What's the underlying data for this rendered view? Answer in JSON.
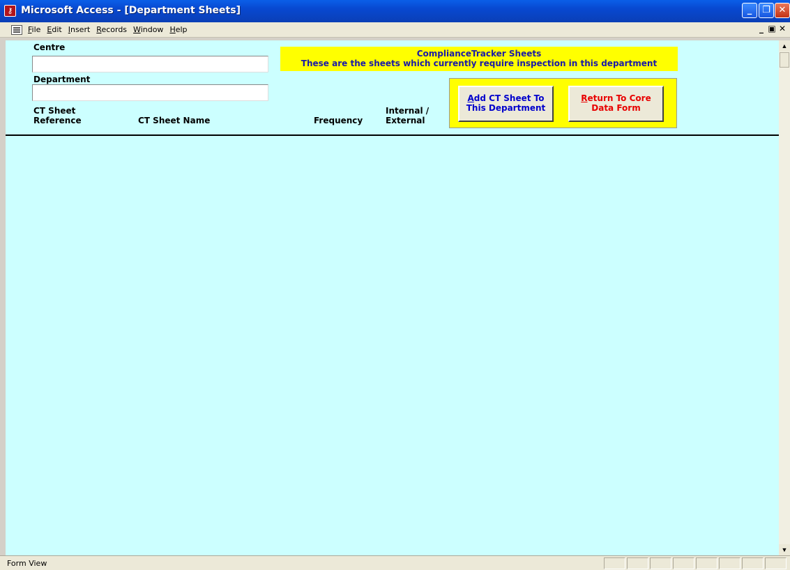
{
  "window": {
    "title": "Microsoft Access - [Department Sheets]",
    "app_icon": "access-key-icon",
    "controls": {
      "minimize": "_",
      "restore": "❐",
      "close": "✕"
    }
  },
  "menu": {
    "items": [
      "File",
      "Edit",
      "Insert",
      "Records",
      "Window",
      "Help"
    ],
    "mdi_controls": {
      "minimize": "_",
      "restore": "▣",
      "close": "✕"
    }
  },
  "form": {
    "centre_label": "Centre",
    "centre_value": "",
    "department_label": "Department",
    "department_value": "",
    "notice": {
      "line1": "ComplianceTracker Sheets",
      "line2": "These are the sheets which currently require inspection in this department"
    },
    "buttons": {
      "add_first": "A",
      "add_rest": "dd CT Sheet To",
      "add_line2": "This Department",
      "return_first": "R",
      "return_rest": "eturn To Core",
      "return_line2": "Data Form"
    },
    "columns": {
      "ref_line1": "CT Sheet",
      "ref_line2": "Reference",
      "name": "CT Sheet Name",
      "frequency": "Frequency",
      "int_line1": "Internal /",
      "int_line2": "External"
    },
    "rows": []
  },
  "scrollbar": {
    "up": "▲",
    "down": "▼"
  },
  "status": {
    "text": "Form View"
  },
  "colors": {
    "form_bg": "#ccffff",
    "highlight": "#ffff00",
    "notice_text": "#1a1aa8",
    "add_text": "#0000cc",
    "return_text": "#e80000"
  }
}
